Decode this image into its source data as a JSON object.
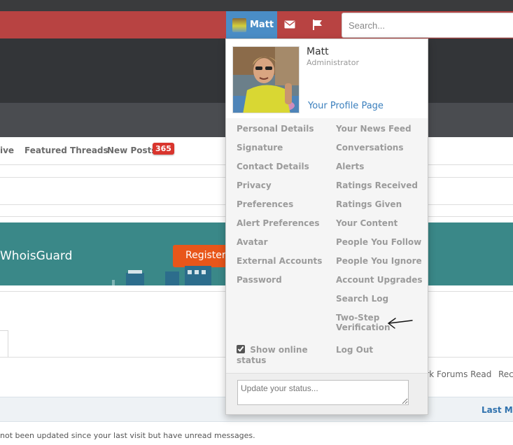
{
  "header": {
    "user_button_name": "Matt",
    "search_placeholder": "Search..."
  },
  "nav": {
    "items": [
      "ive",
      "Featured Threads",
      "New Posts"
    ],
    "new_posts_count": "365"
  },
  "banner": {
    "text": "WhoisGuard",
    "register_label": "Register"
  },
  "forum": {
    "mark_read": "ark Forums Read",
    "recent": "Rec",
    "last_message_header": "Last Me",
    "legend_note": "not been updated since your last visit but have unread messages."
  },
  "dropdown": {
    "name": "Matt",
    "role": "Administrator",
    "profile_link": "Your Profile Page",
    "left_menu": [
      "Personal Details",
      "Signature",
      "Contact Details",
      "Privacy",
      "Preferences",
      "Alert Preferences",
      "Avatar",
      "External Accounts",
      "Password"
    ],
    "right_menu": [
      "Your News Feed",
      "Conversations",
      "Alerts",
      "Ratings Received",
      "Ratings Given",
      "Your Content",
      "People You Follow",
      "People You Ignore",
      "Account Upgrades",
      "Search Log",
      "Two-Step Verification"
    ],
    "show_online_status": "Show online status",
    "show_online_checked": true,
    "logout": "Log Out",
    "status_placeholder": "Update your status..."
  },
  "icons": {
    "conversations": "envelope-icon",
    "alerts": "flag-icon",
    "annotation": "hand-drawn-arrow-icon"
  },
  "colors": {
    "accent_red": "#b84342",
    "user_button_blue": "#4a8dc6",
    "link_blue": "#3a7fbd",
    "badge_red": "#d9352d",
    "register_orange": "#e8561a"
  }
}
